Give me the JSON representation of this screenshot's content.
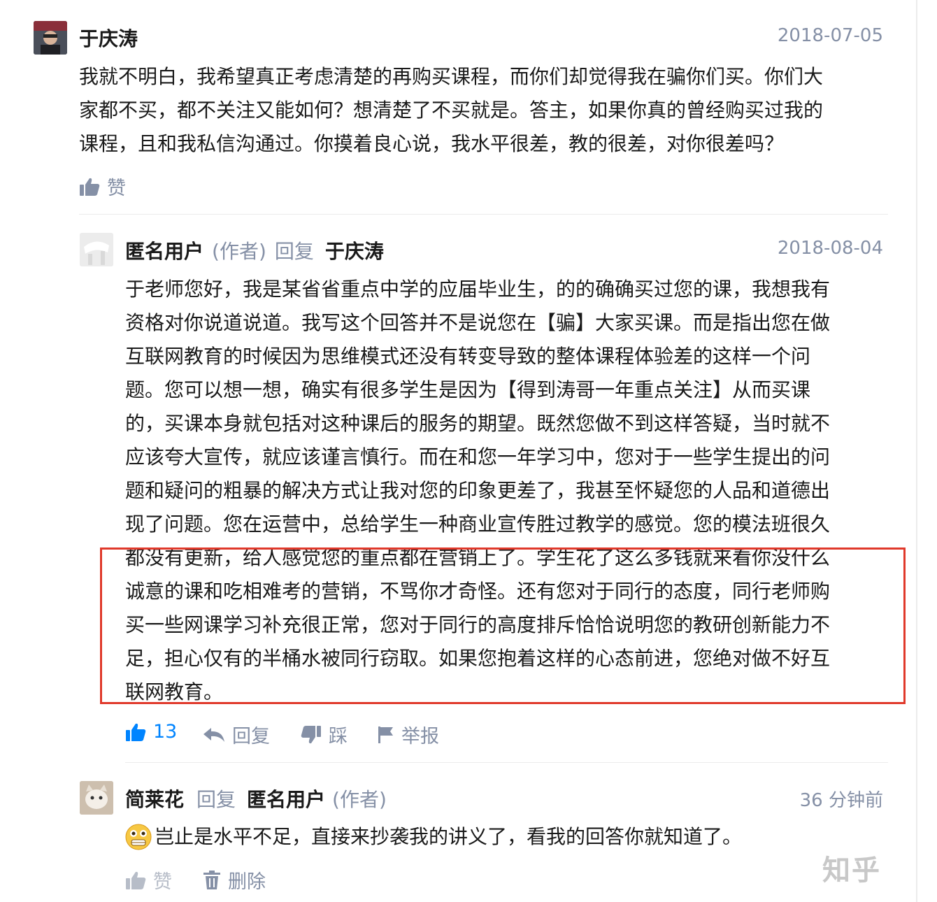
{
  "comments": [
    {
      "author": "于庆涛",
      "date": "2018-07-05",
      "lines": [
        "我就不明白，我希望真正考虑清楚的再购买课程，而你们却觉得我在骗你们买。你们大",
        "家都不买，都不关注又能如何？想清楚了不买就是。答主，如果你真的曾经购买过我的",
        "课程，且和我私信沟通过。你摸着良心说，我水平很差，教的很差，对你很差吗？"
      ],
      "like_label": "赞",
      "icons": {
        "like": "thumbs-up-icon"
      }
    },
    {
      "author": "匿名用户",
      "author_tag": "(作者)",
      "reply_word": "回复",
      "reply_to": "于庆涛",
      "date": "2018-08-04",
      "lines": [
        "于老师您好，我是某省省重点中学的应届毕业生，的的确确买过您的课，我想我有",
        "资格对你说道说道。我写这个回答并不是说您在【骗】大家买课。而是指出您在做",
        "互联网教育的时候因为思维模式还没有转变导致的整体课程体验差的这样一个问",
        "题。您可以想一想，确实有很多学生是因为【得到涛哥一年重点关注】从而买课",
        "的，买课本身就包括对这种课后的服务的期望。既然您做不到这样答疑，当时就不",
        "应该夸大宣传，就应该谨言慎行。而在和您一年学习中，您对于一些学生提出的问",
        "题和疑问的粗暴的解决方式让我对您的印象更差了，我甚至怀疑您的人品和道德出",
        "现了问题。您在运营中，总给学生一种商业宣传胜过教学的感觉。您的模法班很久",
        "都没有更新，给人感觉您的重点都在营销上了。学生花了这么多钱就来看你没什么",
        "诚意的课和吃相难考的营销，不骂你才奇怪。还有您对于同行的态度，同行老师购",
        "买一些网课学习补充很正常，您对于同行的高度排斥恰恰说明您的教研创新能力不",
        "足，担心仅有的半桶水被同行窃取。如果您抱着这样的心态前进，您绝对做不好互",
        "联网教育。"
      ],
      "actions": {
        "like_count": "13",
        "reply": "回复",
        "dislike": "踩",
        "report": "举报"
      },
      "icons": {
        "like": "thumbs-up-icon",
        "reply": "reply-arrow-icon",
        "dislike": "thumbs-down-icon",
        "report": "flag-icon"
      },
      "accent_color": "#0084ff"
    },
    {
      "author": "简莱花",
      "reply_word": "回复",
      "reply_to": "匿名用户",
      "reply_to_tag": "(作者)",
      "date": "36 分钟前",
      "text": "岂止是水平不足，直接来抄袭我的讲义了，看我的回答你就知道了。",
      "emoji_icon": "grimacing-emoji-icon",
      "actions": {
        "like": "赞",
        "delete": "删除"
      },
      "icons": {
        "like": "thumbs-up-icon",
        "delete": "trash-icon"
      }
    }
  ],
  "highlight_color": "#e0392b",
  "watermark": "知乎"
}
